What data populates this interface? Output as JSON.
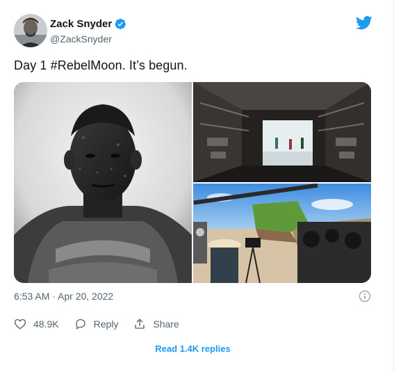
{
  "author": {
    "name": "Zack Snyder",
    "handle": "@ZackSnyder",
    "verified": true,
    "avatar_icon": "profile-photo"
  },
  "brand": {
    "icon": "twitter-bird-icon",
    "color": "#1d9bf0"
  },
  "tweet": {
    "text": "Day 1 #RebelMoon. It’s begun.",
    "timestamp": "6:53 AM · Apr 20, 2022"
  },
  "media": {
    "count": 3,
    "items": [
      "photo-portrait-warrior",
      "photo-spaceship-hangar",
      "photo-desert-film-set"
    ]
  },
  "actions": {
    "likes_count": "48.9K",
    "reply_label": "Reply",
    "share_label": "Share"
  },
  "footer": {
    "replies_link": "Read 1.4K replies"
  },
  "colors": {
    "text_primary": "#0f1419",
    "text_secondary": "#536471",
    "accent": "#1d9bf0"
  }
}
